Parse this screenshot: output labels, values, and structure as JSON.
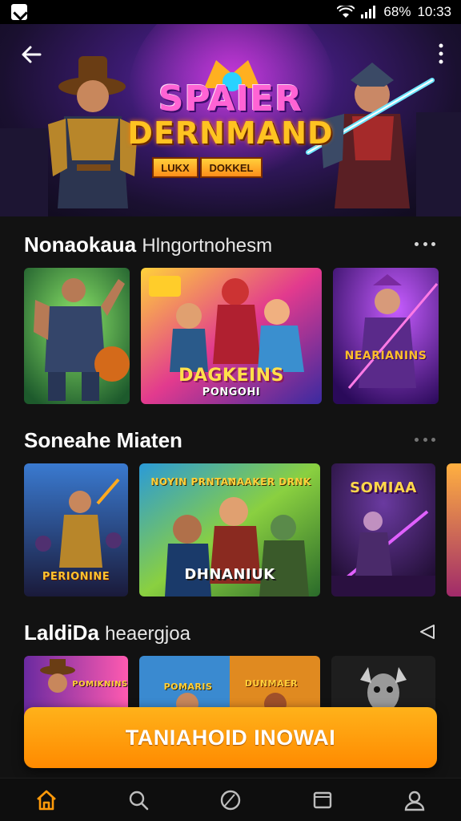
{
  "status_bar": {
    "battery": "68%",
    "time": "10:33"
  },
  "hero": {
    "title_line1": "SPAIER",
    "title_line2": "DERNMAND",
    "badge1": "LUKX",
    "badge2": "DOKKEL"
  },
  "sections": [
    {
      "title": "Nonaokaua",
      "subtitle": "Hlngortnohesm"
    },
    {
      "title": "Soneahe Miaten",
      "subtitle": ""
    },
    {
      "title": "LaldiDa",
      "subtitle": "heaergjoa"
    }
  ],
  "cards": {
    "row1_card2_line1": "DAGKEINS",
    "row1_card2_line2": "PONGOHI",
    "row1_card3": "NEARIANINS",
    "row2_card1": "PERIONINE",
    "row2_card2_top1": "NOYIN PRNTAY",
    "row2_card2_top2": "NAAKER DRNK",
    "row2_card2_bottom": "DHNANIUK",
    "row2_card3": "SOMIAA",
    "row3_card1": "POMIKNINS",
    "row3_card2a": "POMARIS",
    "row3_card2b": "DUNMAER"
  },
  "cta": {
    "label": "TANIAHOID INOWAI"
  },
  "nav": [
    "home-icon",
    "search-icon",
    "activity-icon",
    "library-icon",
    "profile-icon"
  ],
  "colors": {
    "accent": "#ff9a0a",
    "background": "#121212"
  }
}
